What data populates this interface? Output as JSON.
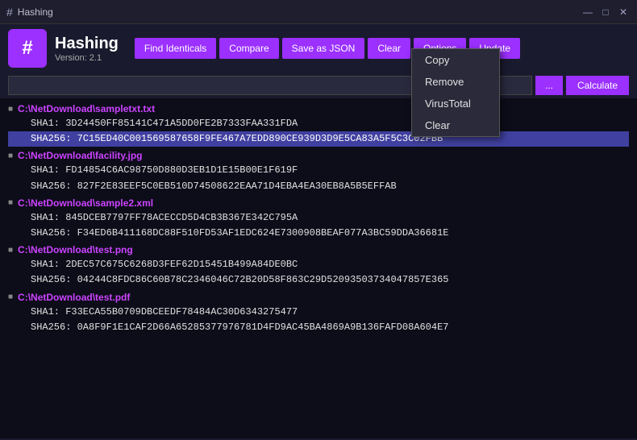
{
  "window": {
    "title": "Hashing",
    "icon": "#"
  },
  "titlebar": {
    "minimize": "—",
    "maximize": "□",
    "close": "✕"
  },
  "app": {
    "name": "Hashing",
    "version": "Version: 2.1",
    "logo_char": "#"
  },
  "toolbar": {
    "find_identicals": "Find Identicals",
    "compare": "Compare",
    "save_as_json": "Save as JSON",
    "clear": "Clear",
    "options": "Options",
    "update": "Update",
    "browse": "...",
    "calculate": "Calculate"
  },
  "path_input": {
    "value": "",
    "placeholder": ""
  },
  "files": [
    {
      "path": "C:\\NetDownload\\sampletxt.txt",
      "hashes": [
        {
          "label": "SHA1:",
          "value": "3D24450FF85141C471A5DD0FE2B7333FAA331FDA",
          "highlighted": false
        },
        {
          "label": "SHA256:",
          "value": "7C15ED40C001569587658F9FE467A7EDD890CE939D3D9E5CA83A5F5C3C02FBB",
          "highlighted": true
        }
      ]
    },
    {
      "path": "C:\\NetDownload\\facility.jpg",
      "hashes": [
        {
          "label": "SHA1:",
          "value": "FD14854C6AC98750D880D3EB1D1E15B00E1F619F",
          "highlighted": false
        },
        {
          "label": "SHA256:",
          "value": "827F2E83EEF5C0EB510D74508622EAA71D4EBA4EA30EB8A5B5EFFAB",
          "highlighted": false
        }
      ]
    },
    {
      "path": "C:\\NetDownload\\sample2.xml",
      "hashes": [
        {
          "label": "SHA1:",
          "value": "845DCEB7797FF78ACECCD5D4CB3B367E342C795A",
          "highlighted": false
        },
        {
          "label": "SHA256:",
          "value": "F34ED6B411168DC88F510FD53AF1EDC624E7300908BEAF077A3BC59DDA36681E",
          "highlighted": false
        }
      ]
    },
    {
      "path": "C:\\NetDownload\\test.png",
      "hashes": [
        {
          "label": "SHA1:",
          "value": "2DEC57C675C6268D3FEF62D15451B499A84DE0BC",
          "highlighted": false
        },
        {
          "label": "SHA256:",
          "value": "04244C8FDC86C60B78C2346046C72B20D58F863C29D52093503734047857E365",
          "highlighted": false
        }
      ]
    },
    {
      "path": "C:\\NetDownload\\test.pdf",
      "hashes": [
        {
          "label": "SHA1:",
          "value": "F33ECA55B0709DBCEEDF78484AC30D6343275477",
          "highlighted": false
        },
        {
          "label": "SHA256:",
          "value": "0A8F9F1E1CAF2D66A65285377976781D4FD9AC45BA4869A9B136FAFD08A604E7",
          "highlighted": false
        }
      ]
    }
  ],
  "context_menu": {
    "items": [
      "Copy",
      "Remove",
      "VirusTotal",
      "Clear"
    ]
  }
}
